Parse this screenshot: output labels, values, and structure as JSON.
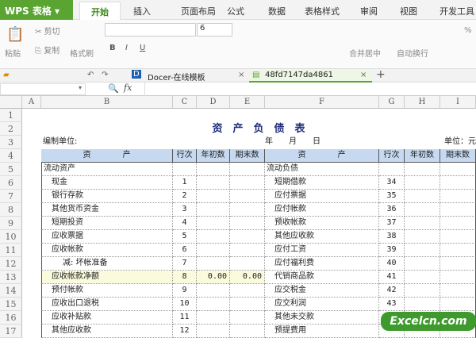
{
  "app": {
    "name": "WPS 表格"
  },
  "menu_tabs": [
    "开始",
    "插入",
    "页面布局",
    "公式",
    "数据",
    "表格样式",
    "审阅",
    "视图",
    "开发工具"
  ],
  "ribbon": {
    "paste": "粘贴",
    "cut": "剪切",
    "copy": "复制",
    "format_painter": "格式刷",
    "font_size": "6",
    "merge_center": "合并居中",
    "wrap_text": "自动换行",
    "percent": "%"
  },
  "doc_tabs": [
    {
      "label": "Docer-在线模板"
    },
    {
      "label": "48fd7147da4861"
    }
  ],
  "formula": {
    "fx": "fx",
    "value": ""
  },
  "columns": [
    "A",
    "B",
    "C",
    "D",
    "E",
    "F",
    "G",
    "H",
    "I"
  ],
  "rows_numbers": [
    "1",
    "2",
    "3",
    "4",
    "5",
    "6",
    "7",
    "8",
    "9",
    "10",
    "11",
    "12",
    "13",
    "14",
    "15",
    "16",
    "17"
  ],
  "sheet": {
    "title": "资　产　负　债　表",
    "unit_left": "编制单位:",
    "date": "年　　月　　日",
    "unit_right": "单位：元",
    "headers": [
      "资　　　　产",
      "行次",
      "年初数",
      "期末数",
      "资　　　　产",
      "行次",
      "年初数",
      "期末数"
    ],
    "rows": [
      [
        "流动资产",
        "",
        "",
        "",
        "流动负债",
        ""
      ],
      [
        "现金",
        "1",
        "",
        "",
        "短期借款",
        "34"
      ],
      [
        "银行存款",
        "2",
        "",
        "",
        "应付票据",
        "35"
      ],
      [
        "其他货币资金",
        "3",
        "",
        "",
        "应付帐款",
        "36"
      ],
      [
        "短期投资",
        "4",
        "",
        "",
        "预收帐款",
        "37"
      ],
      [
        "应收票据",
        "5",
        "",
        "",
        "其他应收款",
        "38"
      ],
      [
        "应收帐款",
        "6",
        "",
        "",
        "应付工资",
        "39"
      ],
      [
        "减: 坏帐准备",
        "7",
        "",
        "",
        "应付福利费",
        "40"
      ],
      [
        "应收帐款净额",
        "8",
        "0.00",
        "0.00",
        "代销商品款",
        "41"
      ],
      [
        "预付帐款",
        "9",
        "",
        "",
        "应交税金",
        "42"
      ],
      [
        "应收出口退税",
        "10",
        "",
        "",
        "应交利润",
        "43"
      ],
      [
        "应收补贴款",
        "11",
        "",
        "",
        "其他未交款",
        ""
      ],
      [
        "其他应收款",
        "12",
        "",
        "",
        "预提费用",
        ""
      ]
    ]
  },
  "watermark": "Excelcn.com"
}
